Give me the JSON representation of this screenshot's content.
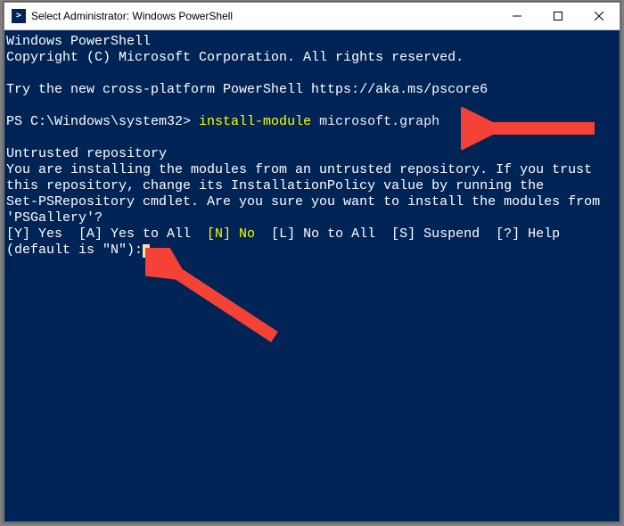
{
  "window": {
    "title": "Select Administrator: Windows PowerShell"
  },
  "terminal": {
    "header1": "Windows PowerShell",
    "header2": "Copyright (C) Microsoft Corporation. All rights reserved.",
    "tryline": "Try the new cross-platform PowerShell https://aka.ms/pscore6",
    "prompt": "PS C:\\Windows\\system32> ",
    "cmd_yellow": "install-module",
    "cmd_rest": " microsoft.graph",
    "warn_title": "Untrusted repository",
    "warn_body": "You are installing the modules from an untrusted repository. If you trust\nthis repository, change its InstallationPolicy value by running the\nSet-PSRepository cmdlet. Are you sure you want to install the modules from\n'PSGallery'?",
    "opt_y": "[Y] Yes  ",
    "opt_a": "[A] Yes to All  ",
    "opt_n": "[N] No",
    "opt_l": "  [L] No to All  ",
    "opt_s": "[S] Suspend  ",
    "opt_h": "[?] Help",
    "default_line": "(default is \"N\"):"
  },
  "annotations": {
    "arrow_color": "#f44336"
  }
}
